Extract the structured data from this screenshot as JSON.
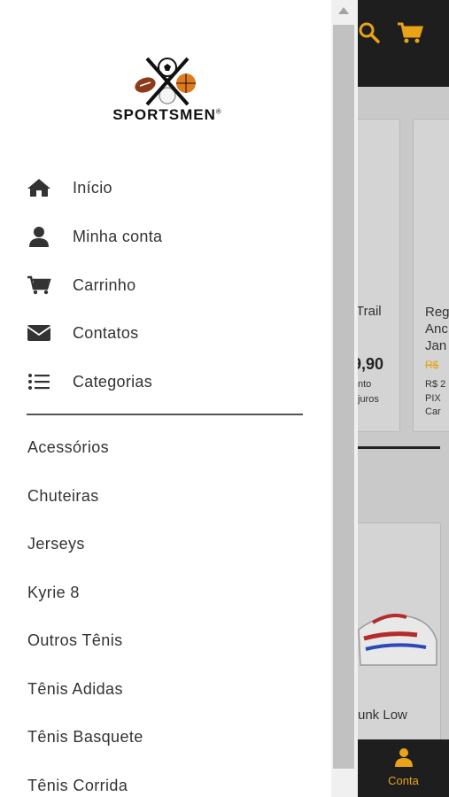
{
  "background": {
    "card1_text": "Trail",
    "card1_price": "9,90",
    "card1_info1": "nto",
    "card1_info2": "juros",
    "card2_text1": "Reg",
    "card2_text2": "Anc",
    "card2_text3": "Jan",
    "card2_price_old": "R$",
    "card2_info1": "R$ 2",
    "card2_info2": "PIX",
    "card2_info3": "Car",
    "card3_text": "unk Low",
    "bottom_nav_label": "Conta"
  },
  "logo": {
    "brand": "SPORTSMEN",
    "registered": "®"
  },
  "menu": {
    "items": [
      {
        "label": "Início",
        "icon": "home-icon"
      },
      {
        "label": "Minha conta",
        "icon": "user-icon"
      },
      {
        "label": "Carrinho",
        "icon": "cart-icon"
      },
      {
        "label": "Contatos",
        "icon": "envelope-icon"
      },
      {
        "label": "Categorias",
        "icon": "list-icon"
      }
    ]
  },
  "categories": [
    "Acessórios",
    "Chuteiras",
    "Jerseys",
    "Kyrie 8",
    "Outros Tênis",
    "Tênis Adidas",
    "Tênis Basquete",
    "Tênis Corrida"
  ],
  "colors": {
    "accent": "#e8a317",
    "dark": "#1e1e1e",
    "text": "#333333"
  }
}
